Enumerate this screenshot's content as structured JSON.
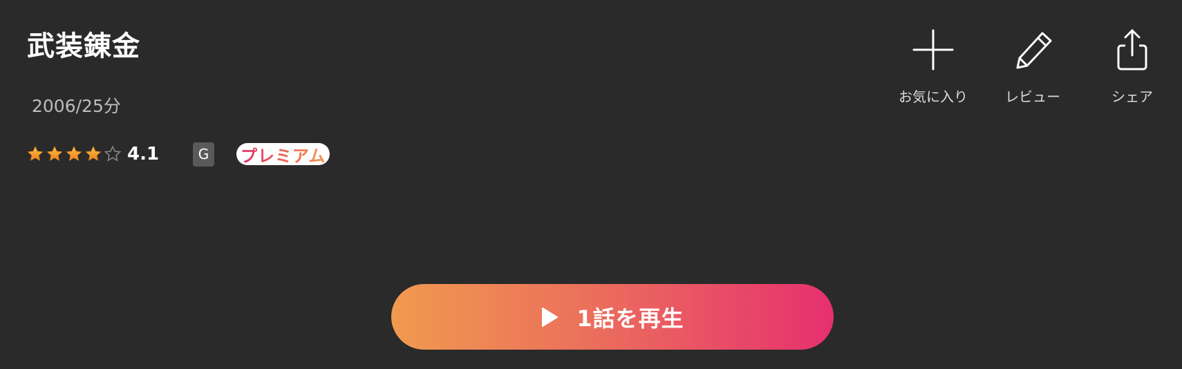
{
  "title": "武装錬金",
  "meta": "2006/25分",
  "rating": {
    "stars": [
      1,
      1,
      1,
      1,
      0
    ],
    "value": "4.1"
  },
  "age_rating": "G",
  "premium_label": "プレミアム",
  "actions": {
    "favorite": {
      "label": "お気に入り",
      "icon": "plus-icon"
    },
    "review": {
      "label": "レビュー",
      "icon": "pencil-icon"
    },
    "share": {
      "label": "シェア",
      "icon": "share-icon"
    }
  },
  "play_button": {
    "label": "1話を再生",
    "icon": "play-icon"
  },
  "colors": {
    "background": "#2a2a2a",
    "star_fill": "#f7a532",
    "gradient_start": "#f09a4f",
    "gradient_end": "#e6306f"
  }
}
